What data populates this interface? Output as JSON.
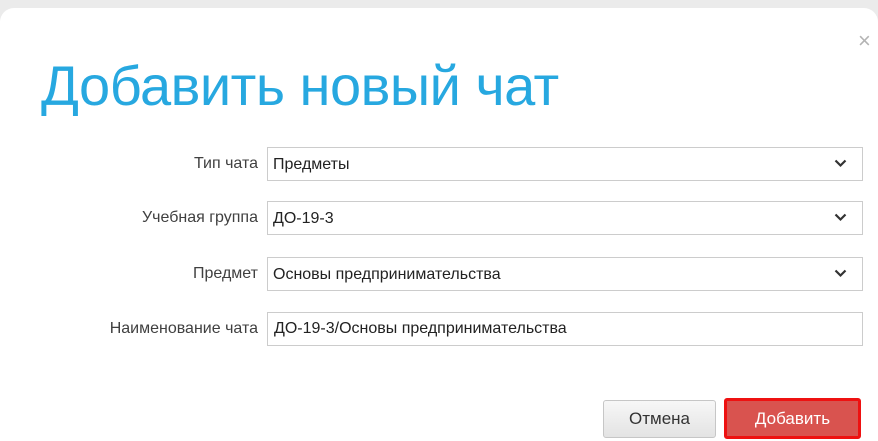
{
  "dialog": {
    "title": "Добавить новый чат",
    "close_glyph": "×"
  },
  "form": {
    "chat_type": {
      "label": "Тип чата",
      "value": "Предметы"
    },
    "study_group": {
      "label": "Учебная группа",
      "value": "ДО-19-3"
    },
    "subject": {
      "label": "Предмет",
      "value": "Основы предпринимательства"
    },
    "chat_name": {
      "label": "Наименование чата",
      "value": "ДО-19-3/Основы предпринимательства"
    }
  },
  "buttons": {
    "cancel_label": "Отмена",
    "add_label": "Добавить"
  },
  "colors": {
    "title": "#27a8e0",
    "add_button": "#d9534f",
    "add_button_highlight": "#ee1111"
  },
  "icons": {
    "close": "close-icon",
    "dropdown": "chevron-down-icon"
  }
}
